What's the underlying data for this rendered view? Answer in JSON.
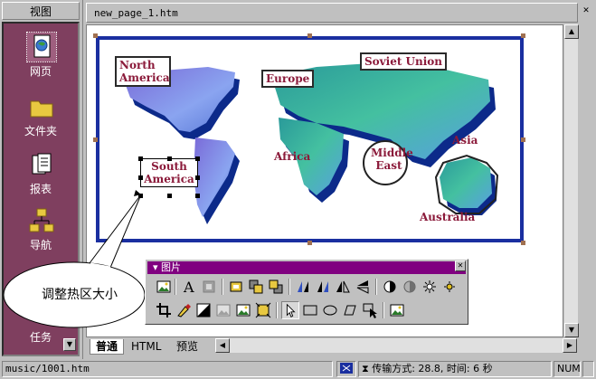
{
  "viewbar": {
    "title": "视图",
    "items": [
      {
        "label": "网页",
        "icon": "web-page-icon"
      },
      {
        "label": "文件夹",
        "icon": "folder-icon"
      },
      {
        "label": "报表",
        "icon": "reports-icon"
      },
      {
        "label": "导航",
        "icon": "navigation-icon"
      },
      {
        "label": "任务",
        "icon": "tasks-icon"
      }
    ]
  },
  "document": {
    "tab_title": "new_page_1.htm",
    "close_glyph": "✕"
  },
  "map": {
    "hotspots": {
      "north_america": "North America",
      "south_america": "South America",
      "europe": "Europe",
      "soviet_union": "Soviet Union",
      "africa": "Africa",
      "middle_east": "Middle East",
      "asia": "Asia",
      "australia": "Australia"
    },
    "frame_color": "#1a2fa0",
    "label_color": "#8b1a3a"
  },
  "callout": {
    "text": "调整热区大小"
  },
  "picture_toolbar": {
    "title": "图片",
    "row1": [
      "insert-picture-icon",
      "text-icon",
      "auto-thumbnail-icon",
      "position-absolutely-icon",
      "bring-forward-icon",
      "send-backward-icon",
      "rotate-left-icon",
      "rotate-right-icon",
      "flip-horizontal-icon",
      "flip-vertical-icon",
      "more-contrast-icon",
      "less-contrast-icon",
      "more-brightness-icon",
      "less-brightness-icon"
    ],
    "row2": [
      "crop-icon",
      "set-transparent-color-icon",
      "black-and-white-icon",
      "wash-out-icon",
      "bevel-icon",
      "resample-icon",
      "select-icon",
      "rectangular-hotspot-icon",
      "circular-hotspot-icon",
      "polygonal-hotspot-icon",
      "highlight-hotspots-icon",
      "restore-icon"
    ]
  },
  "bottom_tabs": [
    {
      "label": "普通",
      "active": true
    },
    {
      "label": "HTML",
      "active": false
    },
    {
      "label": "预览",
      "active": false
    }
  ],
  "statusbar": {
    "path": "music/1001.htm",
    "transfer": "传输方式: 28.8, 时间: 6 秒",
    "num": "NUM"
  }
}
